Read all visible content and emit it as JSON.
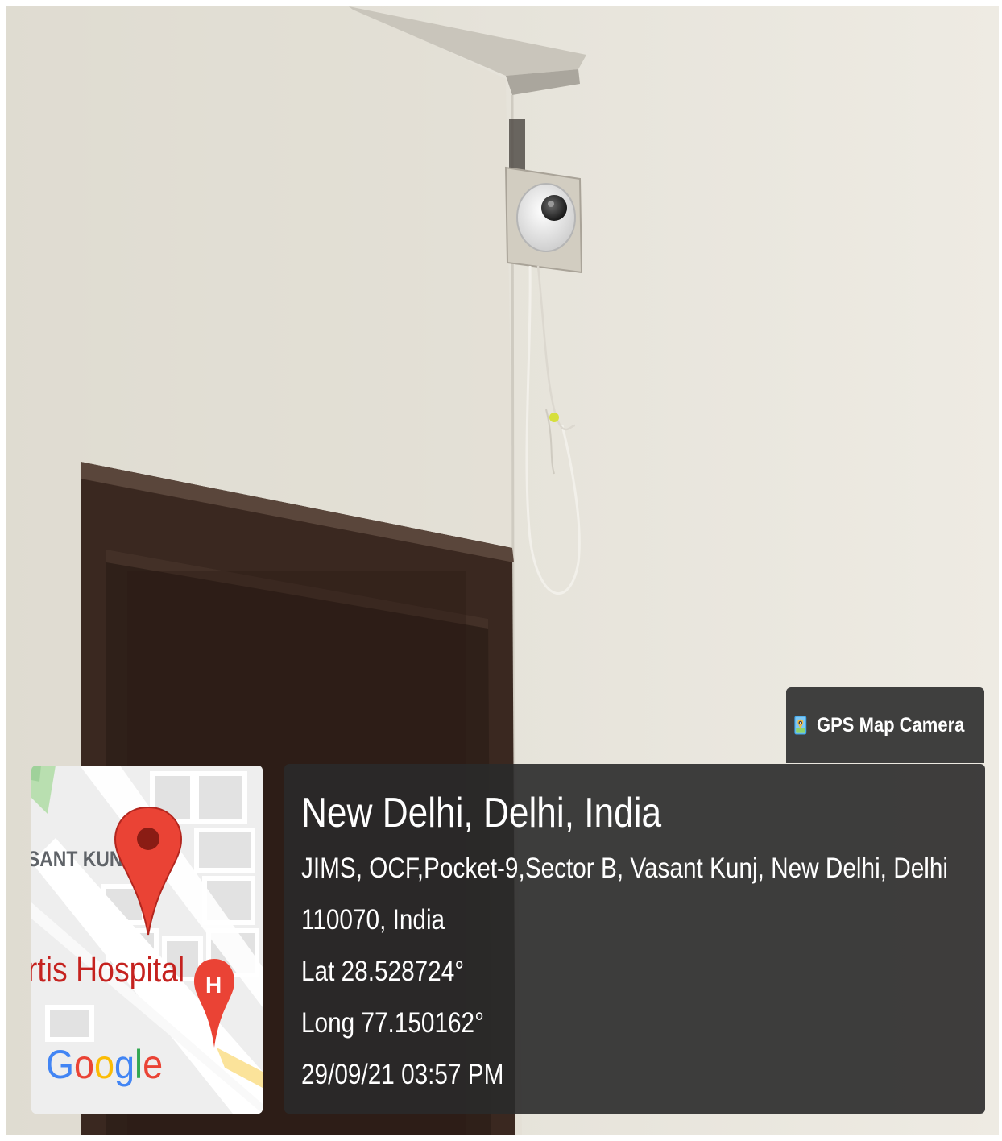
{
  "badge": {
    "app_name": "GPS Map Camera",
    "icon": "gps-map-camera-app-icon"
  },
  "map": {
    "area_label": "SANT KUNJ",
    "poi_label": "rtis Hospital",
    "hospital_marker_letter": "H",
    "brand": "Google",
    "brand_colors": [
      "#4285F4",
      "#EA4335",
      "#FBBC05",
      "#4285F4",
      "#34A853",
      "#EA4335"
    ],
    "pin_color": "#ea4335",
    "pin_icon": "location-pin-icon",
    "hospital_icon": "hospital-pin-icon"
  },
  "location": {
    "title": "New Delhi, Delhi, India",
    "address_line1": "JIMS, OCF,Pocket-9,Sector B, Vasant Kunj, New Delhi, Delhi",
    "address_line2": "110070, India",
    "latitude": "Lat 28.528724°",
    "longitude": "Long 77.150162°",
    "datetime": "29/09/21 03:57 PM"
  },
  "photo": {
    "subject": "dome-cctv-camera",
    "wall_color": "#e9e6dd",
    "door_color": "#3e2a22"
  }
}
